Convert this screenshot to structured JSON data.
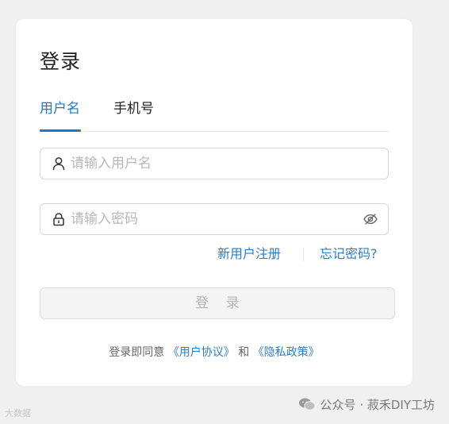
{
  "login": {
    "title": "登录",
    "tabs": [
      {
        "label": "用户名",
        "active": true
      },
      {
        "label": "手机号",
        "active": false
      }
    ],
    "username": {
      "placeholder": "请输入用户名",
      "value": "",
      "icon": "user-icon"
    },
    "password": {
      "placeholder": "请输入密码",
      "value": "",
      "icon": "lock-icon",
      "toggle_icon": "eye-slash-icon"
    },
    "links": {
      "register": "新用户注册",
      "forgot": "忘记密码?"
    },
    "submit_label": "登 录",
    "agreement": {
      "prefix": "登录即同意",
      "user_agreement": "《用户协议》",
      "and": "和",
      "privacy_policy": "《隐私政策》"
    }
  },
  "watermark": {
    "text": "公众号 · 菽禾DIY工坊",
    "icon": "wechat-icon",
    "corner_text": "大数据"
  },
  "colors": {
    "accent": "#1f78c8",
    "link": "#2d7ec4",
    "background": "#f0f0f0",
    "card": "#ffffff"
  }
}
